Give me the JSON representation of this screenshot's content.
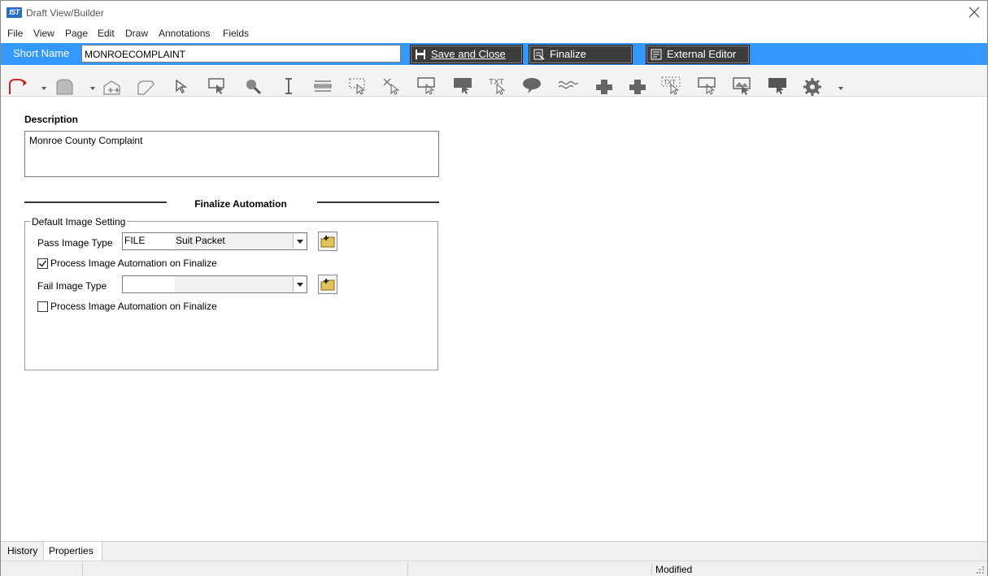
{
  "window": {
    "title": "Draft View/Builder",
    "logo_text": "IST"
  },
  "menu": [
    "File",
    "View",
    "Page",
    "Edit",
    "Draw",
    "Annotations",
    "Fields"
  ],
  "bluebar": {
    "short_name_label": "Short Name",
    "short_name_value": "MONROECOMPLAINT",
    "save_close_label": "Save and Close",
    "finalize_label": "Finalize",
    "external_editor_label": "External Editor",
    "color": "#3399ff"
  },
  "toolbar": {
    "icons": [
      "pen-tool-icon",
      "pen-dropdown-icon",
      "shape-tool-icon",
      "shape-dropdown-icon",
      "add-field-icon",
      "edit-shape-icon",
      "select-arrow-icon",
      "select-region-icon",
      "zoom-icon",
      "text-cursor-icon",
      "text-lines-icon",
      "select-dotted-icon",
      "select-cross-icon",
      "callout-outline-icon",
      "callout-filled-icon",
      "text-callout-icon",
      "speech-bubble-icon",
      "wave-line-icon",
      "cross-filled-icon",
      "cross-filled-2-icon",
      "text-dotted-icon",
      "callout-select-icon",
      "image-icon",
      "callout-dark-icon",
      "gear-icon",
      "gear-dropdown-icon"
    ]
  },
  "description": {
    "label": "Description",
    "value": "Monroe County Complaint"
  },
  "finalize_automation": {
    "title": "Finalize Automation",
    "group_title": "Default Image Setting",
    "pass_image_type_label": "Pass Image Type",
    "pass_image_type_code": "FILE",
    "pass_image_type_name": "Suit Packet",
    "pass_process_checked": true,
    "pass_process_label": "Process Image Automation on Finalize",
    "fail_image_type_label": "Fail Image Type",
    "fail_image_type_code": "",
    "fail_image_type_name": "",
    "fail_process_checked": false,
    "fail_process_label": "Process Image Automation on Finalize"
  },
  "tabs": {
    "history": "History",
    "properties": "Properties"
  },
  "status": {
    "text": "Modified"
  }
}
